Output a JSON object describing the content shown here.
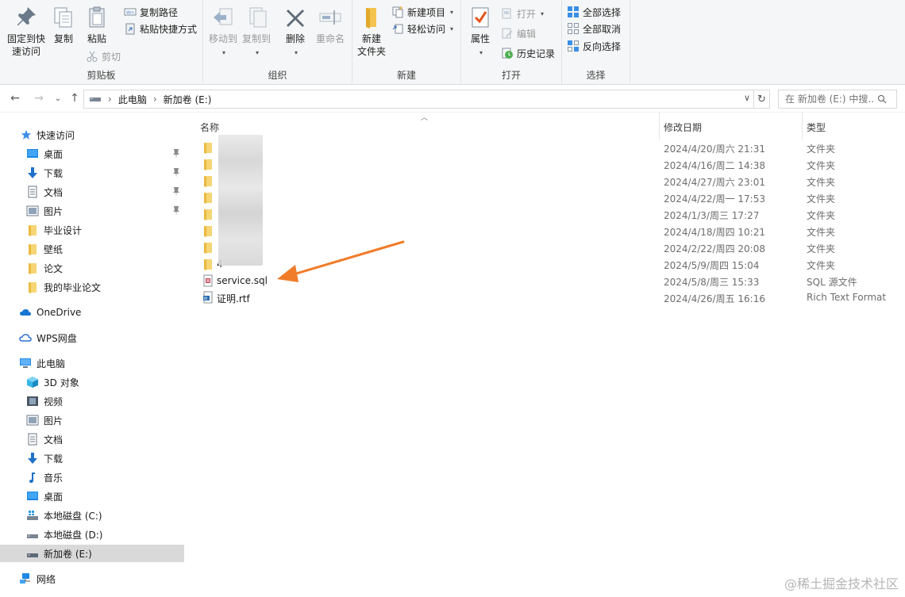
{
  "ribbon": {
    "clipboard": {
      "label": "剪贴板",
      "pin_quick_access": [
        "固定到快",
        "速访问"
      ],
      "copy": "复制",
      "paste": "粘贴",
      "copy_path": "复制路径",
      "paste_shortcut": "粘贴快捷方式",
      "cut": "剪切"
    },
    "organize": {
      "label": "组织",
      "move_to": "移动到",
      "copy_to": "复制到",
      "delete": "删除",
      "rename": "重命名"
    },
    "new": {
      "label": "新建",
      "new_folder": [
        "新建",
        "文件夹"
      ],
      "new_item": "新建项目",
      "easy_access": "轻松访问"
    },
    "open": {
      "label": "打开",
      "properties": "属性",
      "open": "打开",
      "edit": "编辑",
      "history": "历史记录"
    },
    "select": {
      "label": "选择",
      "select_all": "全部选择",
      "select_none": "全部取消",
      "invert": "反向选择"
    }
  },
  "address": {
    "crumbs": [
      "此电脑",
      "新加卷 (E:)"
    ],
    "search_placeholder": "在 新加卷 (E:) 中搜..."
  },
  "sidebar": {
    "items": [
      {
        "label": "快速访问",
        "icon": "star-icon"
      },
      {
        "label": "桌面",
        "icon": "desktop-icon",
        "pinned": true
      },
      {
        "label": "下载",
        "icon": "download-icon",
        "pinned": true
      },
      {
        "label": "文档",
        "icon": "document-icon",
        "pinned": true
      },
      {
        "label": "图片",
        "icon": "picture-icon",
        "pinned": true
      },
      {
        "label": "毕业设计",
        "icon": "folder-icon"
      },
      {
        "label": "壁纸",
        "icon": "folder-icon"
      },
      {
        "label": "论文",
        "icon": "folder-icon"
      },
      {
        "label": "我的毕业论文",
        "icon": "folder-icon"
      },
      {
        "label": "OneDrive",
        "icon": "cloud-icon"
      },
      {
        "label": "WPS网盘",
        "icon": "wps-cloud-icon"
      },
      {
        "label": "此电脑",
        "icon": "computer-icon"
      },
      {
        "label": "3D 对象",
        "icon": "cube-icon"
      },
      {
        "label": "视频",
        "icon": "video-icon"
      },
      {
        "label": "图片",
        "icon": "picture-icon"
      },
      {
        "label": "文档",
        "icon": "document-icon"
      },
      {
        "label": "下载",
        "icon": "download-icon"
      },
      {
        "label": "音乐",
        "icon": "music-icon"
      },
      {
        "label": "桌面",
        "icon": "desktop-icon"
      },
      {
        "label": "本地磁盘 (C:)",
        "icon": "windows-drive-icon"
      },
      {
        "label": "本地磁盘 (D:)",
        "icon": "drive-icon"
      },
      {
        "label": "新加卷 (E:)",
        "icon": "drive-icon",
        "selected": true
      },
      {
        "label": "网络",
        "icon": "network-icon"
      }
    ]
  },
  "columns": {
    "name": "名称",
    "date": "修改日期",
    "type": "类型"
  },
  "files": [
    {
      "name": "",
      "date": "2024/4/20/周六 21:31",
      "type": "文件夹",
      "icon": "folder-icon"
    },
    {
      "name": "",
      "date": "2024/4/16/周二 14:38",
      "type": "文件夹",
      "icon": "folder-icon"
    },
    {
      "name": "",
      "date": "2024/4/27/周六 23:01",
      "type": "文件夹",
      "icon": "folder-icon"
    },
    {
      "name": "",
      "date": "2024/4/22/周一 17:53",
      "type": "文件夹",
      "icon": "folder-icon"
    },
    {
      "name": "",
      "date": "2024/1/3/周三 17:27",
      "type": "文件夹",
      "icon": "folder-icon"
    },
    {
      "name": "",
      "date": "2024/4/18/周四 10:21",
      "type": "文件夹",
      "icon": "folder-icon"
    },
    {
      "name": "",
      "date": "2024/2/22/周四 20:08",
      "type": "文件夹",
      "icon": "folder-icon"
    },
    {
      "name": "4",
      "date": "2024/5/9/周四 15:04",
      "type": "文件夹",
      "icon": "folder-icon"
    },
    {
      "name": "service.sql",
      "date": "2024/5/8/周三 15:33",
      "type": "SQL 源文件",
      "icon": "sql-file-icon"
    },
    {
      "name": "证明.rtf",
      "date": "2024/4/26/周五 16:16",
      "type": "Rich Text Format",
      "icon": "rtf-file-icon"
    }
  ],
  "annotation": {
    "color": "#f07c2a"
  },
  "watermark": "@稀土掘金技术社区"
}
